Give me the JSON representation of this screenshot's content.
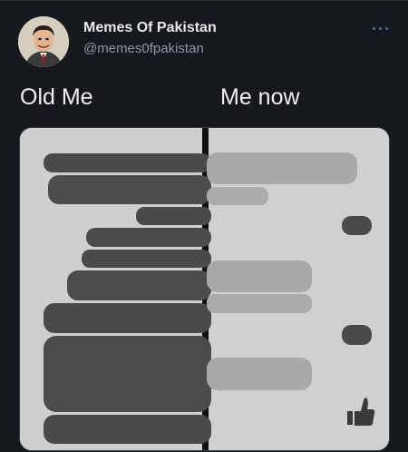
{
  "tweet": {
    "author_name": "Memes Of Pakistan",
    "author_handle": "@memes0fpakistan",
    "more_icon": "more-horizontal-icon"
  },
  "meme": {
    "left_caption": "Old Me",
    "right_caption": "Me now",
    "like_icon": "thumbs-up-icon"
  },
  "colors": {
    "background": "#15181c",
    "name_text": "#e7e9ea",
    "handle_text": "#8b98a5",
    "old_bubbles": "#4b4b4b",
    "new_bubbles": "#a8a8a8",
    "panel_background": "#cdcdcd"
  }
}
